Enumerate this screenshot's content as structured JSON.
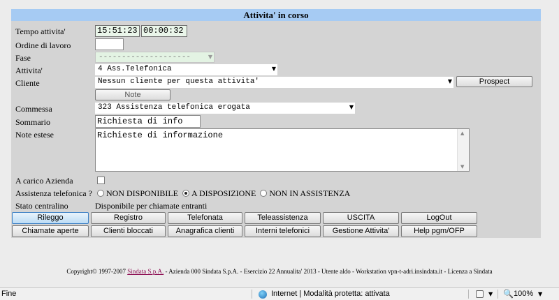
{
  "form": {
    "title": "Attivita' in corso",
    "labels": {
      "tempo": "Tempo attivita'",
      "ordine": "Ordine di lavoro",
      "fase": "Fase",
      "attivita": "Attivita'",
      "cliente": "Cliente",
      "commessa": "Commessa",
      "sommario": "Sommario",
      "note_estese": "Note estese",
      "a_carico": "A carico Azienda",
      "assistenza": "Assistenza telefonica ?",
      "stato": "Stato centralino"
    },
    "time_elapsed": "15:51:23",
    "time_counter": "00:00:32",
    "ordine_value": "",
    "fase_value": "--------------------",
    "attivita_value": "4 Ass.Telefonica",
    "cliente_value": "Nessun cliente per questa attivita'",
    "prospect_label": "Prospect",
    "note_label": "Note",
    "commessa_value": "323 Assistenza telefonica erogata",
    "sommario_value": "Richiesta di info",
    "note_estese_value": "Richieste di informazione",
    "a_carico_checked": false,
    "assistenza_options": [
      "NON DISPONIBILE",
      "A DISPOSIZIONE",
      "NON IN ASSISTENZA"
    ],
    "assistenza_selected": "A DISPOSIZIONE",
    "stato_value": "Disponibile per chiamate entranti"
  },
  "buttons_row1": [
    "Rileggo",
    "Registro",
    "Telefonata",
    "Teleassistenza",
    "USCITA",
    "LogOut"
  ],
  "buttons_row2": [
    "Chiamate aperte",
    "Clienti bloccati",
    "Anagrafica clienti",
    "Interni telefonici",
    "Gestione Attivita'",
    "Help pgm/OFP"
  ],
  "footer": {
    "prefix": "Copyright© 1997-2007 ",
    "link": "Sindata S.p.A.",
    "suffix": " - Azienda 000 Sindata S.p.A. - Esercizio 22 Annualita' 2013 - Utente aldo - Workstation vpn-t-adri.insindata.it - Licenza a Sindata"
  },
  "statusbar": {
    "left": "Fine",
    "zone": "Internet | Modalità protetta: attivata",
    "zoom": "100%"
  }
}
